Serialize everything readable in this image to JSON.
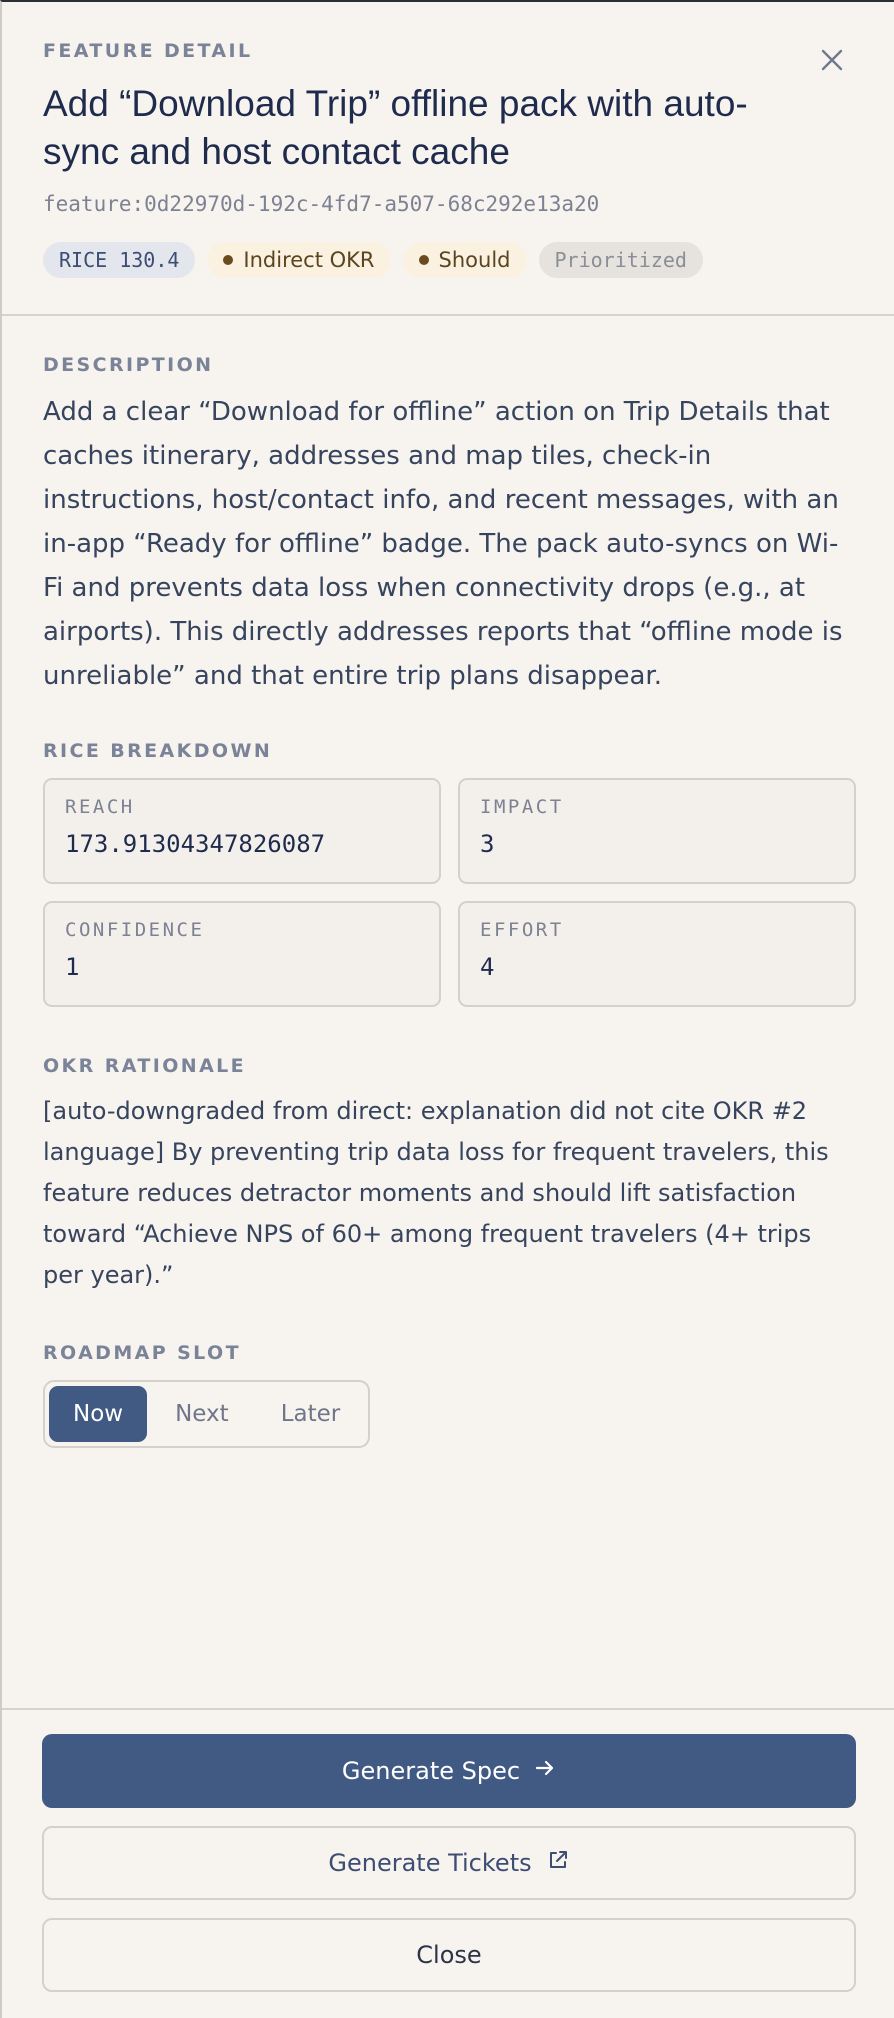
{
  "header": {
    "eyebrow": "FEATURE DETAIL",
    "title": "Add “Download Trip” offline pack with auto-sync and host contact cache",
    "feature_id": "feature:0d22970d-192c-4fd7-a507-68c292e13a20",
    "close_icon": "close-icon",
    "badges": {
      "rice": "RICE 130.4",
      "okr": "Indirect OKR",
      "priority": "Should",
      "status": "Prioritized"
    }
  },
  "description": {
    "label": "DESCRIPTION",
    "text": "Add a clear “Download for offline” action on Trip Details that caches itinerary, addresses and map tiles, check-in instructions, host/contact info, and recent messages, with an in-app “Ready for offline” badge. The pack auto-syncs on Wi-Fi and prevents data loss when connectivity drops (e.g., at airports). This directly addresses reports that “offline mode is unreliable” and that entire trip plans disappear."
  },
  "rice": {
    "label": "RICE BREAKDOWN",
    "cells": [
      {
        "key": "REACH",
        "value": "173.91304347826087"
      },
      {
        "key": "IMPACT",
        "value": "3"
      },
      {
        "key": "CONFIDENCE",
        "value": "1"
      },
      {
        "key": "EFFORT",
        "value": "4"
      }
    ]
  },
  "okr": {
    "label": "OKR RATIONALE",
    "text": "[auto-downgraded from direct: explanation did not cite OKR #2 language] By preventing trip data loss for frequent travelers, this feature reduces detractor moments and should lift satisfaction toward “Achieve NPS of 60+ among frequent travelers (4+ trips per year).”"
  },
  "roadmap": {
    "label": "ROADMAP SLOT",
    "options": [
      "Now",
      "Next",
      "Later"
    ],
    "selected": "Now"
  },
  "footer": {
    "generate_spec": "Generate Spec",
    "generate_tickets": "Generate Tickets",
    "close": "Close"
  },
  "colors": {
    "accent": "#415a84",
    "background": "#f7f3ee",
    "badge_dot": "#6b4a20"
  }
}
